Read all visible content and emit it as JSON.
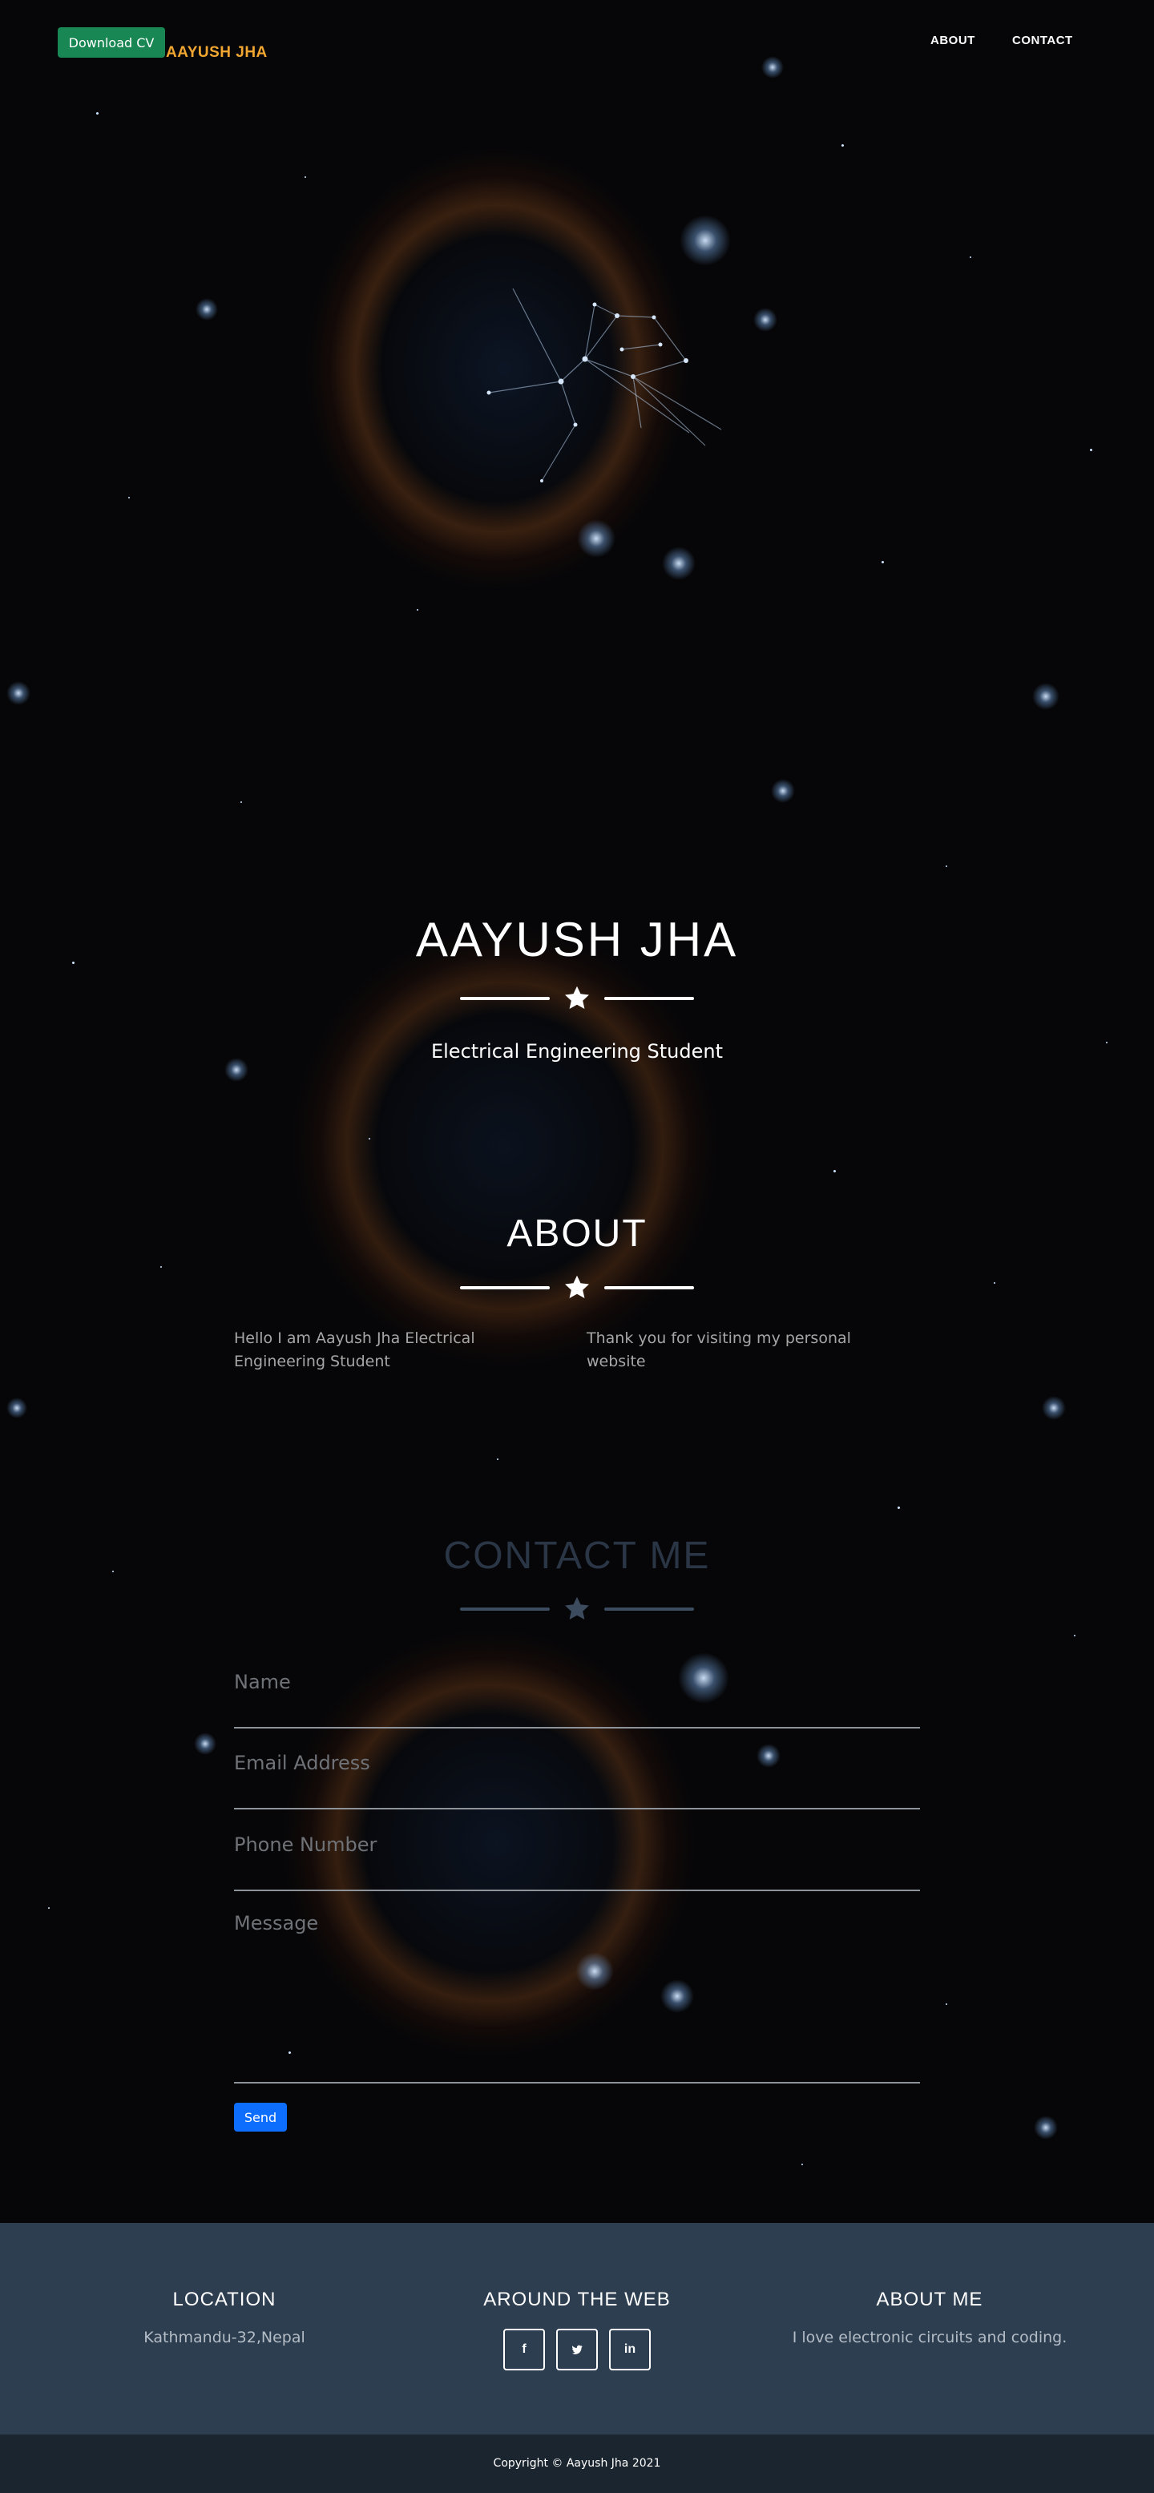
{
  "nav": {
    "download_cv": "Download CV",
    "brand": "AAYUSH JHA",
    "links": [
      "ABOUT",
      "CONTACT"
    ]
  },
  "masthead": {
    "title": "AAYUSH JHA",
    "subtitle": "Electrical Engineering Student",
    "divider_icon": "star-icon"
  },
  "about": {
    "title": "ABOUT",
    "left_text": "Hello I am Aayush Jha Electrical Engineering Student",
    "right_text": "Thank you for visiting my personal website"
  },
  "contact": {
    "title": "CONTACT ME",
    "fields": {
      "name_placeholder": "Name",
      "email_placeholder": "Email Address",
      "phone_placeholder": "Phone Number",
      "message_placeholder": "Message"
    },
    "send_label": "Send"
  },
  "footer": {
    "location": {
      "title": "LOCATION",
      "text": "Kathmandu-32,Nepal"
    },
    "web": {
      "title": "AROUND THE WEB",
      "icons": [
        "facebook-icon",
        "twitter-icon",
        "linkedin-icon"
      ]
    },
    "about_me": {
      "title": "ABOUT ME",
      "text": "I love electronic circuits and coding."
    },
    "copyright": "Copyright © Aayush Jha 2021"
  },
  "colors": {
    "brand": "#f0a630",
    "download_button": "#198754",
    "send_button": "#0d6efd",
    "footer": "#2c3e50",
    "copyright_bar": "#1a252f"
  }
}
